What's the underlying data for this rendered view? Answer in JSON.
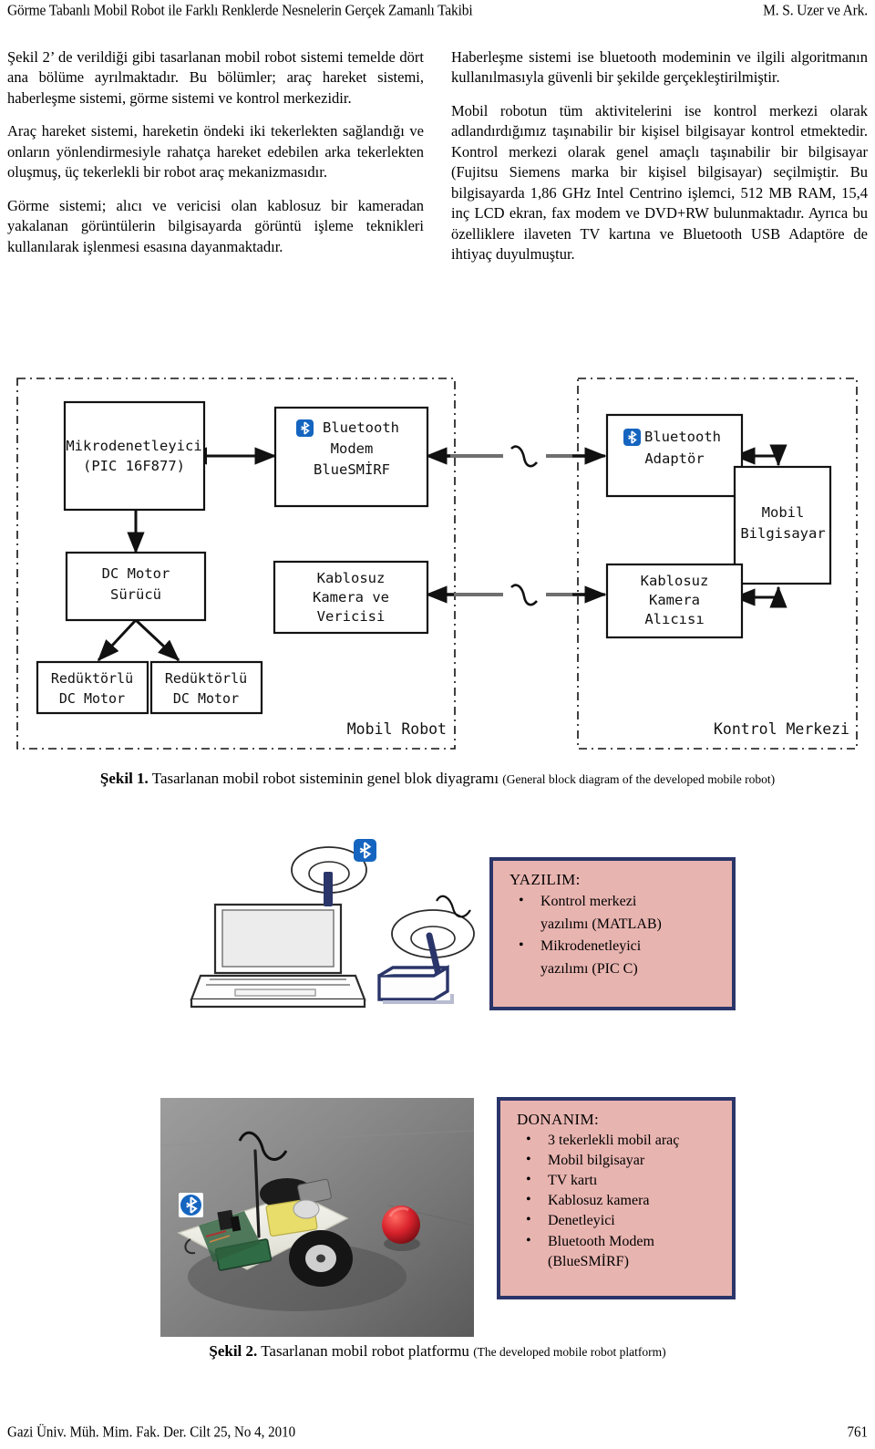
{
  "running_head": {
    "left": "Görme Tabanlı Mobil Robot ile Farklı Renklerde Nesnelerin Gerçek Zamanlı Takibi",
    "right": "M. S. Uzer ve Ark."
  },
  "left_column": {
    "paragraphs": [
      "Şekil 2’ de verildiği gibi tasarlanan mobil robot sistemi temelde dört ana bölüme ayrılmaktadır. Bu bölümler; araç hareket sistemi, haberleşme sistemi, görme sistemi ve kontrol merkezidir.",
      "Araç hareket sistemi, hareketin öndeki iki tekerlekten sağlandığı ve onların yönlendirmesiyle rahatça hareket edebilen arka tekerlekten oluşmuş, üç tekerlekli bir robot araç mekanizmasıdır.",
      "Görme sistemi; alıcı ve vericisi olan kablosuz bir kameradan yakalanan görüntülerin bilgisayarda görüntü işleme teknikleri kullanılarak işlenmesi esasına dayanmaktadır."
    ]
  },
  "right_column": {
    "paragraphs": [
      "Haberleşme sistemi ise bluetooth modeminin ve ilgili algoritmanın kullanılmasıyla güvenli bir şekilde gerçekleştirilmiştir.",
      "Mobil robotun tüm aktivitelerini ise kontrol merkezi olarak adlandırdığımız taşınabilir bir kişisel bilgisayar kontrol etmektedir. Kontrol merkezi olarak genel amaçlı taşınabilir bir bilgisayar (Fujitsu Siemens marka bir kişisel bilgisayar) seçilmiştir. Bu bilgisayarda 1,86 GHz Intel Centrino işlemci, 512 MB RAM, 15,4 inç LCD ekran, fax modem ve DVD+RW bulunmaktadır. Ayrıca bu özelliklere ilaveten TV kartına ve Bluetooth USB Adaptöre de ihtiyaç duyulmuştur."
    ]
  },
  "figure1": {
    "group_left_label": "Mobil Robot",
    "group_right_label": "Kontrol Merkezi",
    "blocks": {
      "microcontroller": {
        "line1": "Mikrodenetleyici",
        "line2": "(PIC 16F877)"
      },
      "bluetooth_modem": {
        "line1": "Bluetooth",
        "line2": "Modem",
        "line3": "BlueSMİRF"
      },
      "dc_motor_driver": {
        "line1": "DC Motor",
        "line2": "Sürücü"
      },
      "wireless_camera_tx": {
        "line1": "Kablosuz",
        "line2": "Kamera ve",
        "line3": "Vericisi"
      },
      "geared_motor_left": {
        "line1": "Redüktörlü",
        "line2": "DC Motor"
      },
      "geared_motor_right": {
        "line1": "Redüktörlü",
        "line2": "DC Motor"
      },
      "bluetooth_adapter": {
        "line1": "Bluetooth",
        "line2": "Adaptör"
      },
      "mobile_computer": {
        "line1": "Mobil",
        "line2": "Bilgisayar"
      },
      "wireless_camera_rx": {
        "line1": "Kablosuz",
        "line2": "Kamera",
        "line3": "Alıcısı"
      }
    }
  },
  "caption1": {
    "number": "Şekil 1.",
    "tr": " Tasarlanan mobil robot sisteminin genel blok diyagramı ",
    "en": "(General block diagram of the developed mobile robot)"
  },
  "figure2": {
    "software_panel": {
      "title": "YAZILIM:",
      "items": [
        "Kontrol merkezi",
        "yazılımı (MATLAB)",
        "Mikrodenetleyici",
        "yazılımı (PIC C)"
      ]
    },
    "hardware_panel": {
      "title": "DONANIM:",
      "items": [
        "3 tekerlekli mobil araç",
        "Mobil bilgisayar",
        "TV kartı",
        "Kablosuz kamera",
        "Denetleyici",
        "Bluetooth Modem",
        "(BlueSMİRF)"
      ]
    }
  },
  "caption2": {
    "number": "Şekil 2.",
    "tr": " Tasarlanan mobil robot platformu ",
    "en": "(The developed mobile robot platform)"
  },
  "footer": {
    "left": "Gazi Üniv. Müh. Mim. Fak. Der. Cilt 25, No 4, 2010",
    "right": "761"
  },
  "colors": {
    "panel_fill": "#e8b4b0",
    "panel_border": "#2a3569",
    "bluetooth_blue": "#1565c0",
    "ball_red": "#cf1e2a"
  }
}
